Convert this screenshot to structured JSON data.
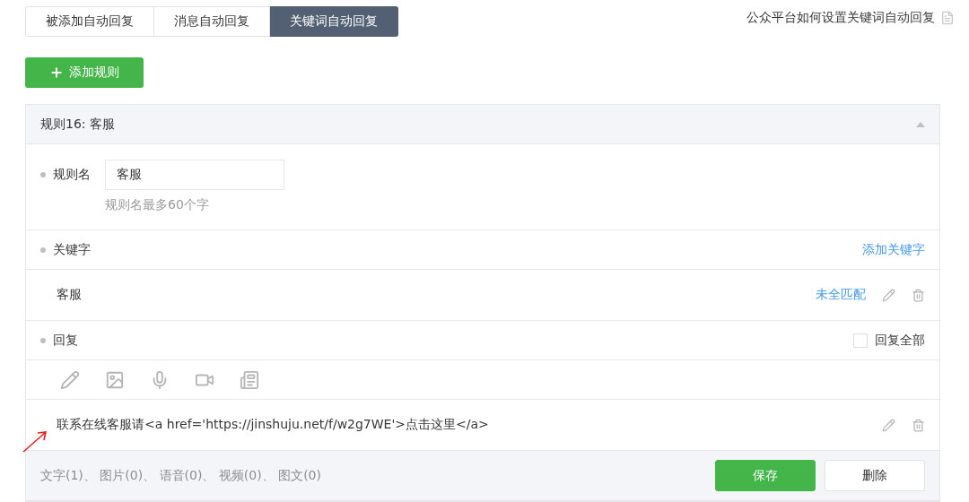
{
  "tabs": [
    {
      "label": "被添加自动回复",
      "selected": false
    },
    {
      "label": "消息自动回复",
      "selected": false
    },
    {
      "label": "关键词自动回复",
      "selected": true
    }
  ],
  "help_link": "公众平台如何设置关键词自动回复",
  "add_rule_button": "添加规则",
  "rule": {
    "title": "规则16: 客服",
    "expanded": true,
    "name_label": "规则名",
    "name_value": "客服",
    "name_hint": "规则名最多60个字",
    "keyword_label": "关键字",
    "add_keyword": "添加关键字",
    "keywords": [
      {
        "text": "客服",
        "match": "未全匹配"
      }
    ],
    "reply_label": "回复",
    "reply_all": {
      "label": "回复全部",
      "checked": false
    },
    "reply_types": [
      {
        "kind": "text"
      },
      {
        "kind": "image"
      },
      {
        "kind": "voice"
      },
      {
        "kind": "video"
      },
      {
        "kind": "article"
      }
    ],
    "replies": [
      {
        "text": "联系在线客服请<a href='https://jinshuju.net/f/w2g7WE'>点击这里</a>",
        "annotated": true
      }
    ],
    "summary": "文字(1)、 图片(0)、 语音(0)、 视频(0)、 图文(0)",
    "buttons": [
      {
        "label": "保存",
        "kind": "primary"
      },
      {
        "label": "删除",
        "kind": "default"
      }
    ]
  }
}
